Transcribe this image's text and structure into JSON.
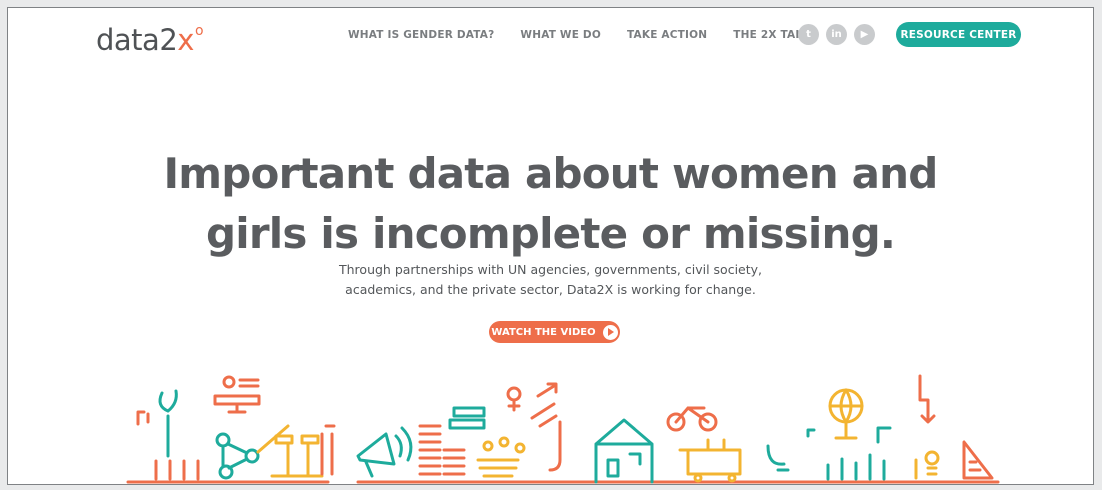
{
  "logo": {
    "text": "data2",
    "x": "x",
    "sup": "o"
  },
  "nav": [
    {
      "label": "WHAT IS GENDER DATA?"
    },
    {
      "label": "WHAT WE DO"
    },
    {
      "label": "TAKE ACTION"
    },
    {
      "label": "THE 2X TAKE"
    }
  ],
  "social": [
    {
      "icon": "twitter-icon",
      "glyph": "t"
    },
    {
      "icon": "linkedin-icon",
      "glyph": "in"
    },
    {
      "icon": "youtube-icon",
      "glyph": "▶"
    }
  ],
  "resource_button": "RESOURCE CENTER",
  "headline": {
    "line1": "Important data about women and",
    "line2": "girls is incomplete or missing."
  },
  "subtext": {
    "line1": "Through partnerships with UN agencies, governments, civil society,",
    "line2": "academics, and the private sector, Data2X is working for change."
  },
  "video_button": "WATCH THE VIDEO",
  "colors": {
    "orange": "#ee6e4a",
    "teal": "#1eab9c",
    "yellow": "#f3b431",
    "gray": "#5a5c5f"
  }
}
